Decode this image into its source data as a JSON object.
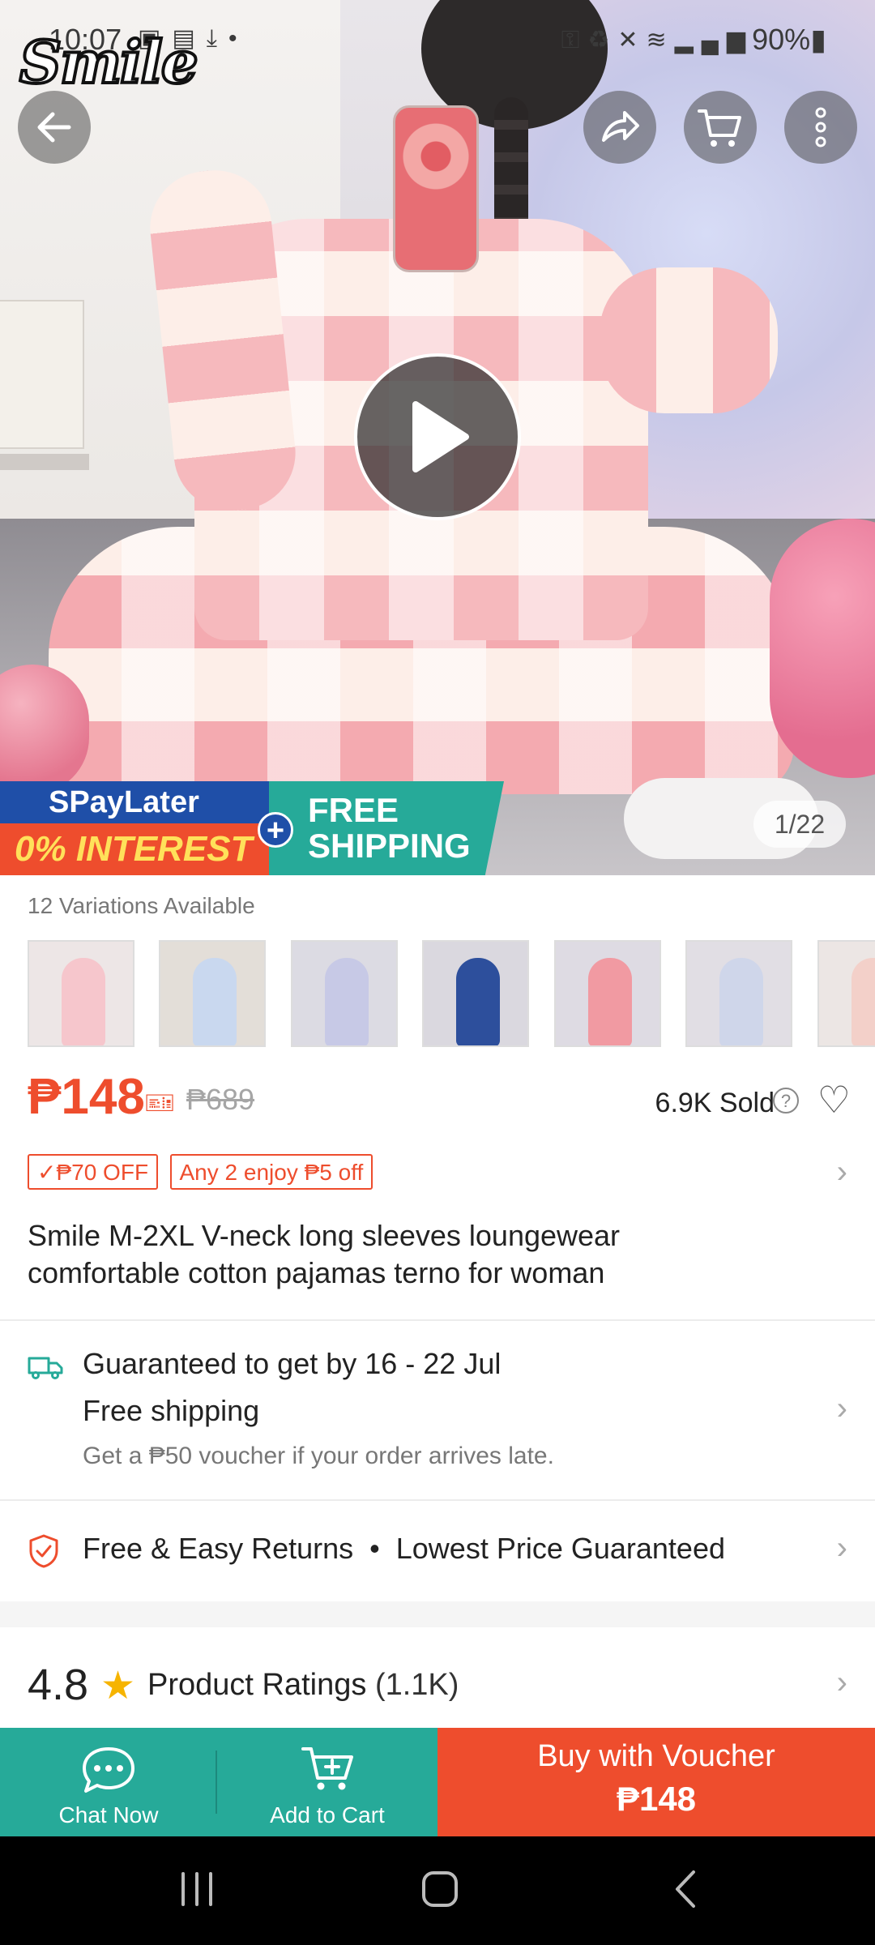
{
  "status_bar": {
    "time": "10:07",
    "battery": "90%",
    "left_icons": [
      "image-icon",
      "document-icon",
      "download-icon",
      "dot-icon"
    ],
    "right_icons": [
      "key-icon",
      "battery-saver-icon",
      "mute-icon",
      "wifi-icon",
      "signal-icon",
      "battery-icon"
    ]
  },
  "brand": {
    "logo_text": "Smile"
  },
  "hero": {
    "image_counter": "1/22",
    "promo": {
      "spaylater": "SPayLater",
      "interest": "0% INTEREST",
      "free_shipping_line1": "FREE",
      "free_shipping_line2": "SHIPPING"
    }
  },
  "variations": {
    "label": "12 Variations Available",
    "thumb_colors": [
      "#f6c6cc",
      "#c9d8ef",
      "#c7c9e6",
      "#2d4f9c",
      "#f19aa2",
      "#cfd6ea",
      "#f3d0c9"
    ]
  },
  "pricing": {
    "price": "₱148",
    "original_price": "₱689",
    "sold": "6.9K Sold"
  },
  "offers": {
    "tag1": "✓₱70 OFF",
    "tag2": "Any 2 enjoy ₱5 off"
  },
  "product": {
    "title": "Smile M-2XL V-neck long sleeves loungewear comfortable cotton pajamas terno for woman"
  },
  "shipping": {
    "guarantee": "Guaranteed to get by 16 - 22 Jul",
    "free": "Free shipping",
    "late_voucher": "Get a ₱50 voucher if your order arrives late."
  },
  "returns": {
    "text": "Free & Easy Returns",
    "separator": "•",
    "lowest": "Lowest Price Guaranteed"
  },
  "ratings": {
    "score": "4.8",
    "label": "Product Ratings",
    "count": "(1.1K)"
  },
  "actions": {
    "chat": "Chat Now",
    "cart": "Add to Cart",
    "buy_line1": "Buy with Voucher",
    "buy_line2": "₱148"
  },
  "colors": {
    "accent": "#ee4d2d",
    "teal": "#26aa99",
    "star": "#f6b400"
  }
}
